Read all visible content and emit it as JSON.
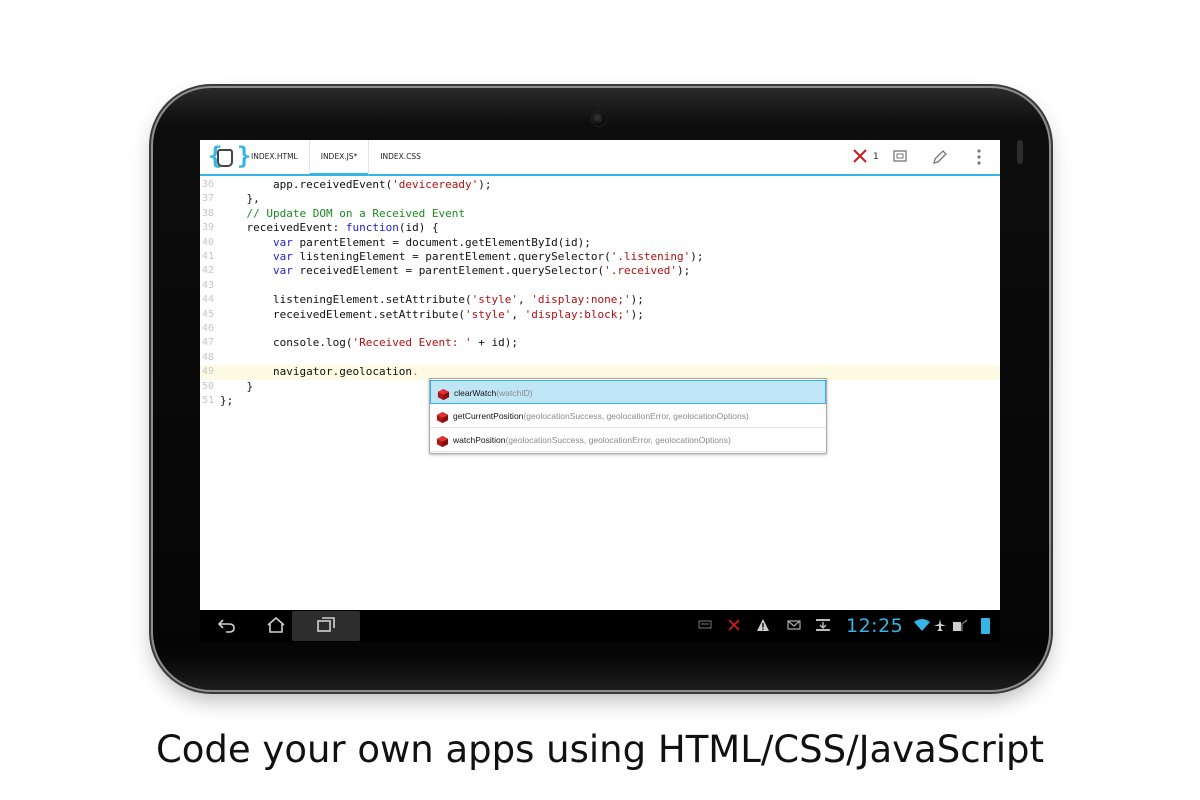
{
  "tabs": [
    {
      "label": "INDEX.HTML",
      "active": false
    },
    {
      "label": "INDEX.JS",
      "modified_marker": "*",
      "active": true
    },
    {
      "label": "INDEX.CSS",
      "active": false
    }
  ],
  "actionbar": {
    "error_count": "1",
    "icons": [
      "close-x-icon",
      "fullscreen-icon",
      "edit-pencil-icon",
      "overflow-menu-icon"
    ]
  },
  "editor": {
    "current_line": 49,
    "lines": [
      {
        "n": "36",
        "segments": [
          [
            "",
            "        app.receivedEvent("
          ],
          [
            "str",
            "'deviceready'"
          ],
          [
            "",
            ");"
          ]
        ]
      },
      {
        "n": "37",
        "segments": [
          [
            "",
            "    },"
          ]
        ]
      },
      {
        "n": "38",
        "segments": [
          [
            "cmt",
            "    // Update DOM on a Received Event"
          ]
        ]
      },
      {
        "n": "39",
        "segments": [
          [
            "",
            "    receivedEvent: "
          ],
          [
            "kw",
            "function"
          ],
          [
            "",
            "(id) {"
          ]
        ]
      },
      {
        "n": "40",
        "segments": [
          [
            "kw",
            "        var"
          ],
          [
            "",
            " parentElement = document.getElementById(id);"
          ]
        ]
      },
      {
        "n": "41",
        "segments": [
          [
            "kw",
            "        var"
          ],
          [
            "",
            " listeningElement = parentElement.querySelector("
          ],
          [
            "str",
            "'.listening'"
          ],
          [
            "",
            ");"
          ]
        ]
      },
      {
        "n": "42",
        "segments": [
          [
            "kw",
            "        var"
          ],
          [
            "",
            " receivedElement = parentElement.querySelector("
          ],
          [
            "str",
            "'.received'"
          ],
          [
            "",
            ");"
          ]
        ]
      },
      {
        "n": "43",
        "segments": [
          [
            "",
            ""
          ]
        ]
      },
      {
        "n": "44",
        "segments": [
          [
            "",
            "        listeningElement.setAttribute("
          ],
          [
            "str",
            "'style'"
          ],
          [
            "",
            ", "
          ],
          [
            "str",
            "'display:none;'"
          ],
          [
            "",
            ");"
          ]
        ]
      },
      {
        "n": "45",
        "segments": [
          [
            "",
            "        receivedElement.setAttribute("
          ],
          [
            "str",
            "'style'"
          ],
          [
            "",
            ", "
          ],
          [
            "str",
            "'display:block;'"
          ],
          [
            "",
            ");"
          ]
        ]
      },
      {
        "n": "46",
        "segments": [
          [
            "",
            ""
          ]
        ]
      },
      {
        "n": "47",
        "segments": [
          [
            "",
            "        console.log("
          ],
          [
            "str",
            "'Received Event: '"
          ],
          [
            "",
            " + id);"
          ]
        ]
      },
      {
        "n": "48",
        "segments": [
          [
            "",
            ""
          ]
        ]
      },
      {
        "n": "49",
        "segments": [
          [
            "",
            "        navigator.geolocation"
          ],
          [
            "squiggle",
            "."
          ]
        ]
      },
      {
        "n": "50",
        "segments": [
          [
            "",
            "    }"
          ]
        ]
      },
      {
        "n": "51",
        "segments": [
          [
            "",
            "};"
          ]
        ]
      }
    ]
  },
  "autocomplete": {
    "items": [
      {
        "name": "clearWatch",
        "params": "(watchID)",
        "selected": true
      },
      {
        "name": "getCurrentPosition",
        "params": "(geolocationSuccess, geolocationError, geolocationOptions)",
        "selected": false
      },
      {
        "name": "watchPosition",
        "params": "(geolocationSuccess, geolocationError, geolocationOptions)",
        "selected": false
      }
    ],
    "item_icon": "red-cube-icon"
  },
  "system_bar": {
    "clock": "12:25",
    "nav_icons": [
      "back-icon",
      "home-icon",
      "recents-icon"
    ],
    "status_icons": [
      "keyboard-icon",
      "error-x-icon",
      "warning-icon",
      "notification-icon",
      "download-icon",
      "wifi-icon",
      "airplane-icon",
      "sd-card-icon",
      "battery-icon"
    ],
    "accent_color": "#33b5e5"
  },
  "caption": "Code your own apps using HTML/CSS/JavaScript"
}
